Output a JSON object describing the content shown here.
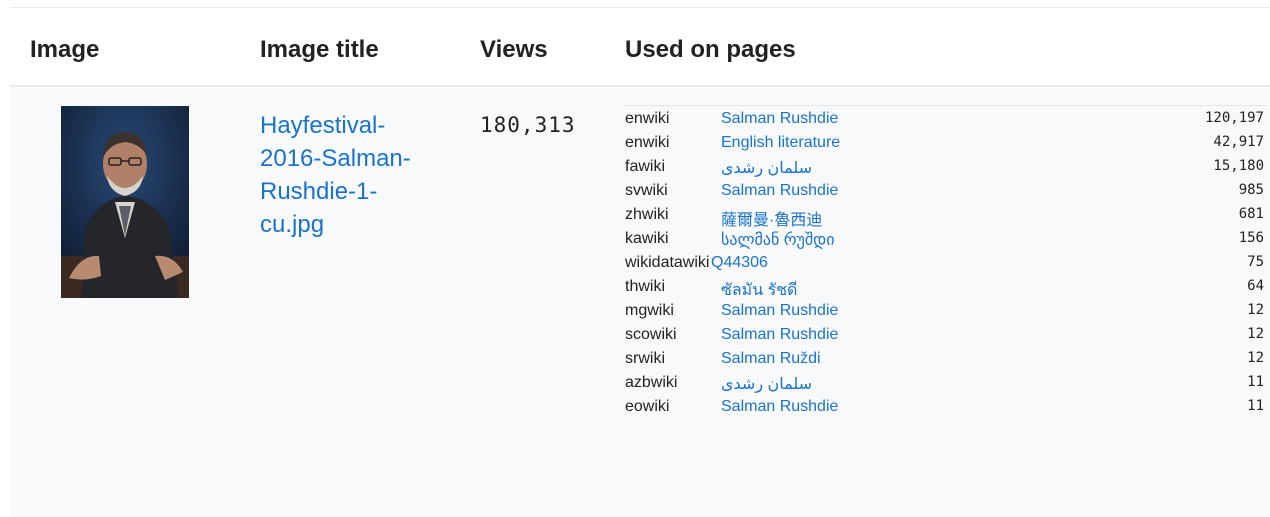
{
  "table": {
    "headers": {
      "image": "Image",
      "image_title": "Image title",
      "views": "Views",
      "used_on_pages": "Used on pages"
    },
    "row": {
      "image_title": "Hayfestival-2016-Salman-Rushdie-1-cu.jpg",
      "views": "180,313",
      "usage": [
        {
          "wiki": "enwiki",
          "page": "Salman Rushdie",
          "views": "120,197"
        },
        {
          "wiki": "enwiki",
          "page": "English literature",
          "views": "42,917"
        },
        {
          "wiki": "fawiki",
          "page": "سلمان رشدی",
          "views": "15,180"
        },
        {
          "wiki": "svwiki",
          "page": "Salman Rushdie",
          "views": "985"
        },
        {
          "wiki": "zhwiki",
          "page": "薩爾曼·魯西迪",
          "views": "681"
        },
        {
          "wiki": "kawiki",
          "page": "სალმან რუშდი",
          "views": "156"
        },
        {
          "wiki": "wikidatawiki",
          "page": "Q44306",
          "views": "75"
        },
        {
          "wiki": "thwiki",
          "page": "ซัลมัน รัชดี",
          "views": "64"
        },
        {
          "wiki": "mgwiki",
          "page": "Salman Rushdie",
          "views": "12"
        },
        {
          "wiki": "scowiki",
          "page": "Salman Rushdie",
          "views": "12"
        },
        {
          "wiki": "srwiki",
          "page": "Salman Ruždi",
          "views": "12"
        },
        {
          "wiki": "azbwiki",
          "page": "سلمان رشدی",
          "views": "11"
        },
        {
          "wiki": "eowiki",
          "page": "Salman Rushdie",
          "views": "11"
        }
      ]
    }
  },
  "colors": {
    "link": "#1a73c8",
    "row_background": "#f8f9fa",
    "header_border": "#eaecf0"
  }
}
